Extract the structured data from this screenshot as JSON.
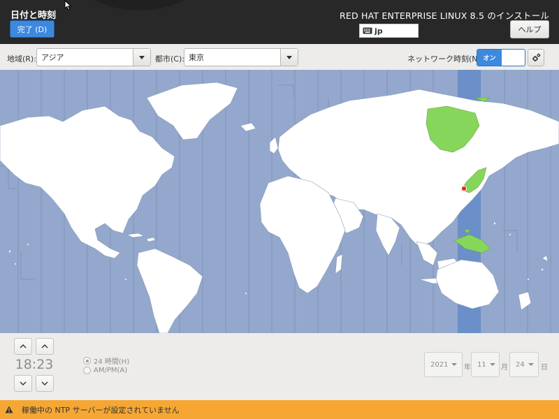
{
  "header": {
    "page_title": "日付と時刻",
    "done_button": "完了 (D)",
    "install_title": "RED HAT ENTERPRISE LINUX 8.5 のインストール",
    "keyboard_layout": "jp",
    "help_button": "ヘルプ"
  },
  "toolbar": {
    "region_label": "地域(R):",
    "region_value": "アジア",
    "city_label": "都市(C):",
    "city_value": "東京",
    "network_time_label": "ネットワーク時刻(N)",
    "network_time_on": "オン"
  },
  "map": {
    "selected_timezone_color": "#86d65b",
    "selected_band_color": "#6b8fc8",
    "land_color": "#ffffff",
    "ocean_color": "#93a8cc"
  },
  "time": {
    "value": "18:23",
    "format_24h": "24 時間(H)",
    "format_ampm": "AM/PM(A)",
    "selected_format": "24h"
  },
  "date": {
    "year": "2021",
    "year_unit": "年",
    "month": "11",
    "month_unit": "月",
    "day": "24",
    "day_unit": "日"
  },
  "warning": {
    "message": "稼働中の NTP サーバーが設定されていません",
    "color": "#f6a733"
  }
}
